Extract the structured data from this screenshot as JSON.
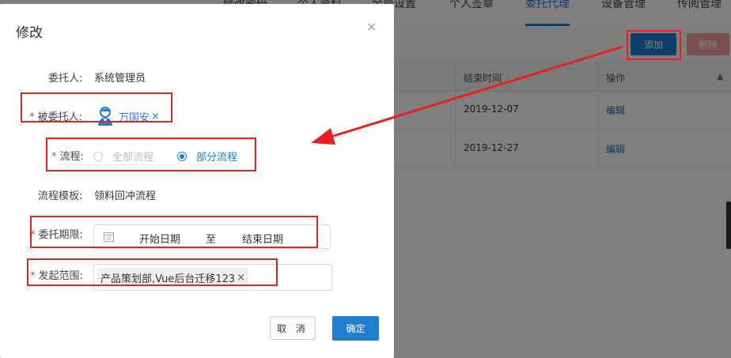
{
  "background": {
    "tabs": [
      "修改密码",
      "个人资料",
      "全局设置",
      "个人签章",
      "委托代理",
      "设备管理",
      "传阅管理"
    ],
    "active_tab": "委托代理",
    "toolbar": {
      "add_label": "添加",
      "delete_label": "删除"
    },
    "table": {
      "columns": [
        "结束时间",
        "操作"
      ],
      "rows": [
        {
          "end_date": "2019-12-07",
          "action": "编辑"
        },
        {
          "end_date": "2019-12-27",
          "action": "编辑"
        }
      ]
    }
  },
  "modal": {
    "title": "修改",
    "close_glyph": "×",
    "delegator": {
      "label": "委托人:",
      "value": "系统管理员"
    },
    "delegatee": {
      "required": "*",
      "label": "被委托人:",
      "name": "万国安",
      "remove": "×"
    },
    "process": {
      "required": "*",
      "label": "流程:",
      "options": [
        {
          "label": "全部流程",
          "selected": false,
          "disabled": true
        },
        {
          "label": "部分流程",
          "selected": true,
          "disabled": false
        }
      ]
    },
    "template": {
      "label": "流程模板:",
      "value": "领料回冲流程"
    },
    "period": {
      "required": "*",
      "label": "委托期限:",
      "start_placeholder": "开始日期",
      "separator": "至",
      "end_placeholder": "结束日期"
    },
    "scope": {
      "required": "*",
      "label": "发起范围:",
      "tag": "产品策划部,Vue后台迁移123",
      "remove": "×"
    },
    "cancel_label": "取 消",
    "ok_label": "确定"
  },
  "colors": {
    "primary": "#1f7ed0",
    "annotation": "#e82020",
    "required": "#e0393e"
  }
}
